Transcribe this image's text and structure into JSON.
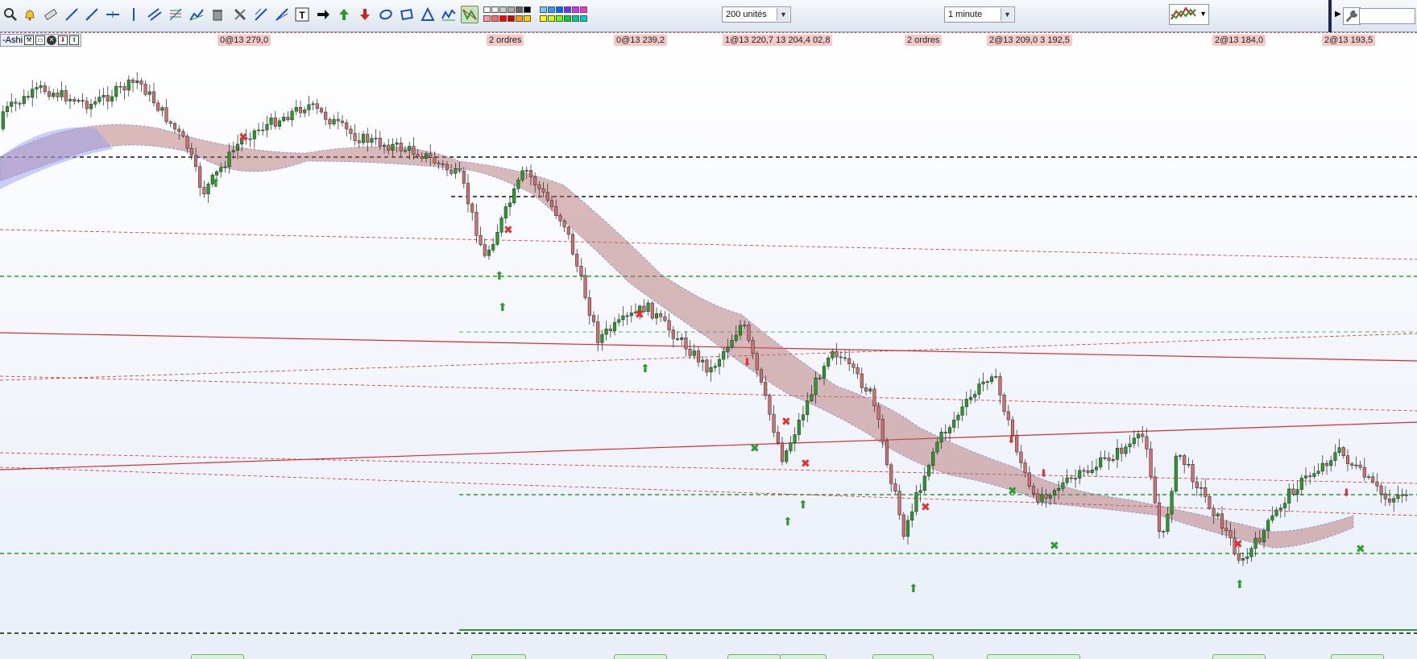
{
  "toolbar": {
    "period_select": "200 unités",
    "interval_select": "1 minute",
    "icons": [
      "magnifier-icon",
      "bell-icon",
      "ruler-icon",
      "line-icon",
      "ray-icon",
      "horizontal-line-icon",
      "vertical-line-icon",
      "parallel-channel-icon",
      "fibonacci-icon",
      "gann-icon",
      "trash-icon",
      "tools-icon",
      "regression-icon",
      "fan-icon",
      "text-icon",
      "arrow-right-icon",
      "arrow-up-icon",
      "arrow-down-icon",
      "ellipse-icon",
      "rectangle-icon",
      "triangle-icon",
      "wave-icon",
      "zigzag-icon"
    ]
  },
  "chart": {
    "tag_label": "-Ashi",
    "order_labels": [
      {
        "text": "0@13 279,0"
      },
      {
        "text": "2 ordres"
      },
      {
        "text": "0@13 239,2"
      },
      {
        "text": "1@13 220,7 13 204,4 02,8"
      },
      {
        "text": "2 ordres"
      },
      {
        "text": "2@13 209,0 3 192,5"
      },
      {
        "text": "2@13 184,0"
      },
      {
        "text": "2@13 193,5"
      }
    ]
  },
  "colors": {
    "bull": "#2a9a2a",
    "bear": "#d07070",
    "cloud_bear": "#b06868",
    "cloud_bull": "#9aa0ee",
    "support": "#2a9a2a",
    "resistance": "#d03030",
    "level": "#111111"
  }
}
